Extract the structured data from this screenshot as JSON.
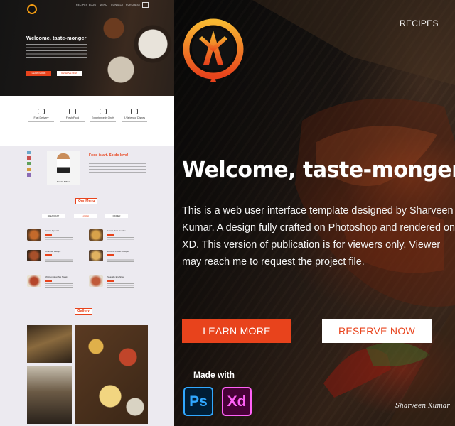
{
  "hero": {
    "nav_recipes": "RECIPES",
    "title": "Welcome, taste-monger",
    "description": "This is a web user interface template designed by Sharveen Kumar.  A  design fully crafted on Photoshop and rendered on XD. This version of publication is for viewers only. Viewer may reach me to request the project file.",
    "learn_more": "LEARN MORE",
    "reserve_now": "RESERVE NOW",
    "made_with": "Made with",
    "apps": [
      "Ps",
      "Xd"
    ],
    "signature": "Sharveen Kumar",
    "logo_icon": "chef-hat-logo-icon",
    "accent_color": "#e8431c"
  },
  "preview": {
    "nav": [
      "RECIPES",
      "BLOG",
      "MENU",
      "CONTACT",
      "PURCHASE"
    ],
    "title": "Welcome, taste-monger",
    "learn_more": "LEARN MORE",
    "reserve_now": "RESERVE NOW",
    "features": [
      {
        "label": "Fast Delivery",
        "icon": "truck-icon"
      },
      {
        "label": "Fresh Food",
        "icon": "leaf-icon"
      },
      {
        "label": "Experience in Chefs",
        "icon": "chef-hat-icon"
      },
      {
        "label": "A Variety of Dishes",
        "icon": "cloche-icon"
      }
    ],
    "food_art_heading": "Food is art. So do love!",
    "chef_name": "Hasan Gikçe",
    "our_menu": "Our Menu",
    "menu_tabs": [
      "BREAKFAST",
      "LUNCH",
      "DINNER"
    ],
    "dishes": [
      "Indian Special",
      "Lunch Pork Combo",
      "Chinese Delight",
      "Luxuria Potato Wedges",
      "WeRunMeat Tak Steak",
      "Seaside Enchilas"
    ],
    "gallery": "Gallery"
  }
}
